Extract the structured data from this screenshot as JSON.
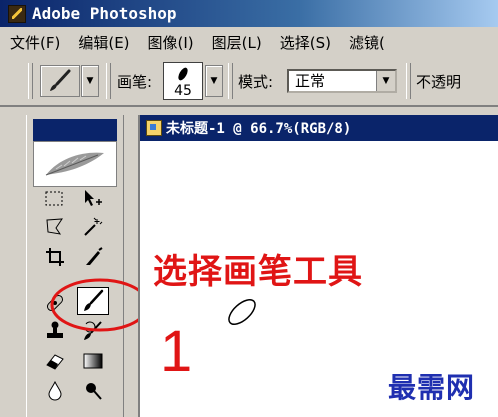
{
  "app": {
    "title": "Adobe Photoshop",
    "icon": "photoshop-app-icon"
  },
  "menubar": {
    "items": [
      {
        "label": "文件(F)"
      },
      {
        "label": "编辑(E)"
      },
      {
        "label": "图像(I)"
      },
      {
        "label": "图层(L)"
      },
      {
        "label": "选择(S)"
      },
      {
        "label": "滤镜("
      }
    ]
  },
  "options_bar": {
    "brush_label": "画笔:",
    "brush_size": "45",
    "mode_label": "模式:",
    "mode_value": "正常",
    "opacity_label": "不透明"
  },
  "document": {
    "title": "未标题-1 @ 66.7%(RGB/8)"
  },
  "annotation": {
    "instruction": "选择画笔工具",
    "step": "1",
    "color": "#e01515"
  },
  "watermark": {
    "text": "最需网",
    "color": "#1f2fb0"
  },
  "toolbox": {
    "selected_tool": "brush-tool",
    "tools": [
      "marquee-tool",
      "move-tool",
      "lasso-tool",
      "magic-wand-tool",
      "crop-tool",
      "slice-tool",
      "healing-brush-tool",
      "brush-tool",
      "clone-stamp-tool",
      "history-brush-tool",
      "eraser-tool",
      "gradient-tool",
      "blur-tool",
      "dodge-tool"
    ]
  }
}
